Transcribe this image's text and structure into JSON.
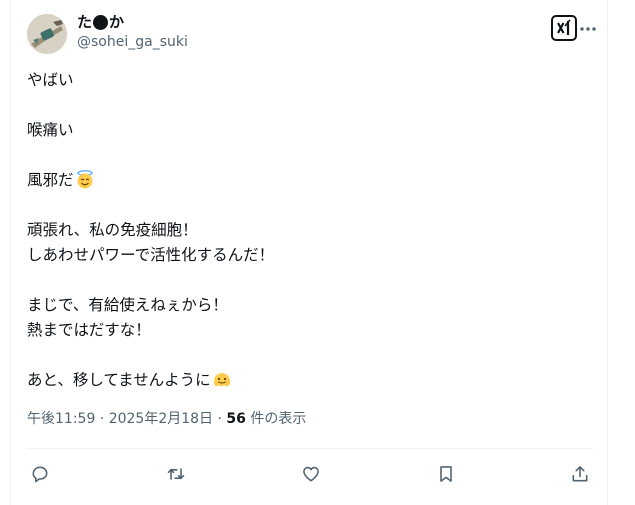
{
  "user": {
    "name_part1": "た",
    "name_part2": "か",
    "handle": "@sohei_ga_suki"
  },
  "tweet": {
    "lines": [
      "やばい",
      "",
      "喉痛い",
      "",
      "風邪だ",
      "",
      "頑張れ、私の免疫細胞！",
      "しあわせパワーで活性化するんだ！",
      "",
      "まじで、有給使えねぇから！",
      "熱まではだすな！",
      "",
      "あと、移してませんように"
    ]
  },
  "meta": {
    "timestamp": "午後11:59 · 2025年2月18日 · ",
    "views_count": "56",
    "views_label": " 件の表示"
  },
  "icons": {
    "grok": "grok-icon",
    "more": "more-icon",
    "reply": "reply-icon",
    "retweet": "retweet-icon",
    "like": "like-icon",
    "bookmark": "bookmark-icon",
    "share": "share-icon",
    "halo_emoji": "halo-emoji-icon",
    "melting_emoji": "melting-face-emoji-icon"
  },
  "colors": {
    "text": "#0f1419",
    "secondary": "#536471",
    "border": "#eff3f4"
  }
}
